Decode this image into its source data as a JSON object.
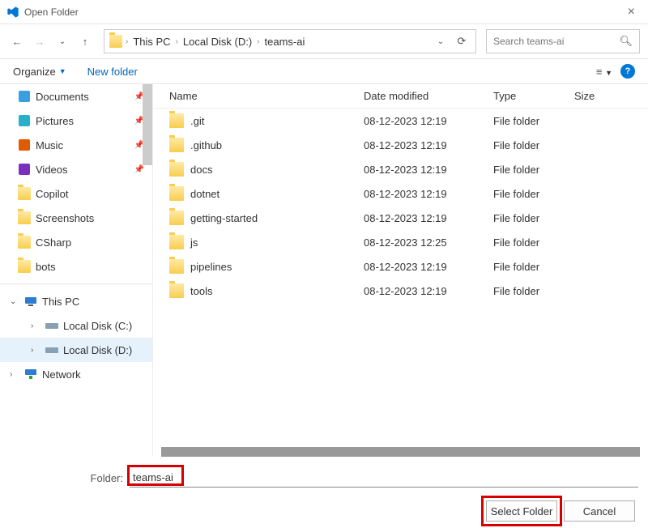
{
  "window": {
    "title": "Open Folder"
  },
  "nav": {
    "breadcrumbs": [
      "This PC",
      "Local Disk (D:)",
      "teams-ai"
    ],
    "search_placeholder": "Search teams-ai"
  },
  "toolbar": {
    "organize": "Organize",
    "new_folder": "New folder"
  },
  "sidebar": {
    "quick": [
      {
        "label": "Documents",
        "icon": "documents",
        "pinned": true
      },
      {
        "label": "Pictures",
        "icon": "pictures",
        "pinned": true
      },
      {
        "label": "Music",
        "icon": "music",
        "pinned": true
      },
      {
        "label": "Videos",
        "icon": "videos",
        "pinned": true
      },
      {
        "label": "Copilot",
        "icon": "folder"
      },
      {
        "label": "Screenshots",
        "icon": "folder"
      },
      {
        "label": "CSharp",
        "icon": "folder"
      },
      {
        "label": "bots",
        "icon": "folder"
      }
    ],
    "pc": {
      "label": "This PC",
      "children": [
        {
          "label": "Local Disk (C:)",
          "icon": "drive"
        },
        {
          "label": "Local Disk (D:)",
          "icon": "drive",
          "selected": true
        }
      ]
    },
    "network": {
      "label": "Network"
    }
  },
  "columns": {
    "name": "Name",
    "date": "Date modified",
    "type": "Type",
    "size": "Size"
  },
  "files": [
    {
      "name": ".git",
      "date": "08-12-2023 12:19",
      "type": "File folder"
    },
    {
      "name": ".github",
      "date": "08-12-2023 12:19",
      "type": "File folder"
    },
    {
      "name": "docs",
      "date": "08-12-2023 12:19",
      "type": "File folder"
    },
    {
      "name": "dotnet",
      "date": "08-12-2023 12:19",
      "type": "File folder"
    },
    {
      "name": "getting-started",
      "date": "08-12-2023 12:19",
      "type": "File folder"
    },
    {
      "name": "js",
      "date": "08-12-2023 12:25",
      "type": "File folder"
    },
    {
      "name": "pipelines",
      "date": "08-12-2023 12:19",
      "type": "File folder"
    },
    {
      "name": "tools",
      "date": "08-12-2023 12:19",
      "type": "File folder"
    }
  ],
  "footer": {
    "label": "Folder:",
    "value": "teams-ai",
    "select": "Select Folder",
    "cancel": "Cancel"
  }
}
